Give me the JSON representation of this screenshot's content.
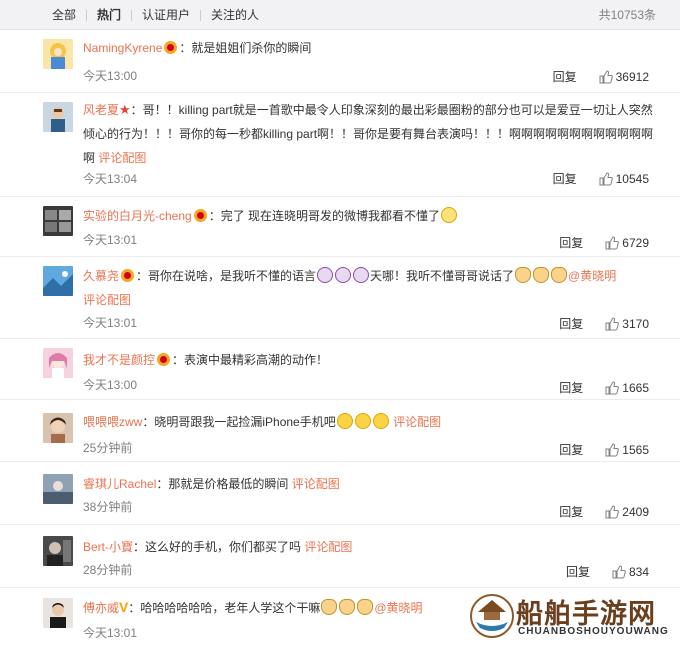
{
  "filters": [
    "全部",
    "热门",
    "认证用户",
    "关注的人"
  ],
  "total": "共10753条",
  "reply_label": "回复",
  "icons": {
    "like": "thumbs-up-icon",
    "avatar": "user-avatar",
    "emoji": "emoji-icon"
  },
  "colors": {
    "username": "#eb7350",
    "meta": "#808080",
    "filterbar": "#f2f2f5"
  },
  "comments": [
    {
      "user": "NamingKyrene",
      "text": "：就是姐姐们杀你的瞬间",
      "time": "今天13:00",
      "likes": "36912"
    },
    {
      "user": "风老夏",
      "text": "：哥！！killing part就是一首歌中最令人印象深刻的最出彩最圈粉的部分也可以是爱豆一切让人突然倾心的行为！！！哥你的每一秒都killing part啊！！哥你是要有舞台表演吗！！！啊啊啊啊啊啊啊啊啊啊啊啊啊",
      "link": "评论配图",
      "time": "今天13:04",
      "likes": "10545"
    },
    {
      "user": "实验的白月光-cheng",
      "text": "：完了 现在连晓明哥发的微博我都看不懂了",
      "time": "今天13:01",
      "likes": "6729"
    },
    {
      "user": "久慕尧",
      "text": "：哥你在说啥，是我听不懂的语言",
      "text2": "天哪！我听不懂哥哥说话了",
      "mention": "@黄晓明",
      "link": "评论配图",
      "time": "今天13:01",
      "likes": "3170"
    },
    {
      "user": "我才不是颜控",
      "text": "：表演中最精彩高潮的动作！",
      "time": "今天13:00",
      "likes": "1665"
    },
    {
      "user": "喂喂喂zww",
      "text": "：晓明哥跟我一起捡漏iPhone手机吧",
      "link": "评论配图",
      "time": "25分钟前",
      "likes": "1565"
    },
    {
      "user": "睿琪儿Rachel",
      "text": "：那就是价格最低的瞬间",
      "link": "评论配图",
      "time": "38分钟前",
      "likes": "2409"
    },
    {
      "user": "Bert-小寶",
      "text": "：这么好的手机，你们都买了吗",
      "link": "评论配图",
      "time": "28分钟前",
      "likes": "834"
    },
    {
      "user": "傅亦威",
      "text": "：哈哈哈哈哈哈，老年人学这个干嘛",
      "mention": "@黄晓明",
      "time": "今天13:01",
      "likes": ""
    }
  ],
  "watermark": {
    "title": "船舶手游网",
    "subtitle": "CHUANBOSHOUYOUWANG"
  }
}
